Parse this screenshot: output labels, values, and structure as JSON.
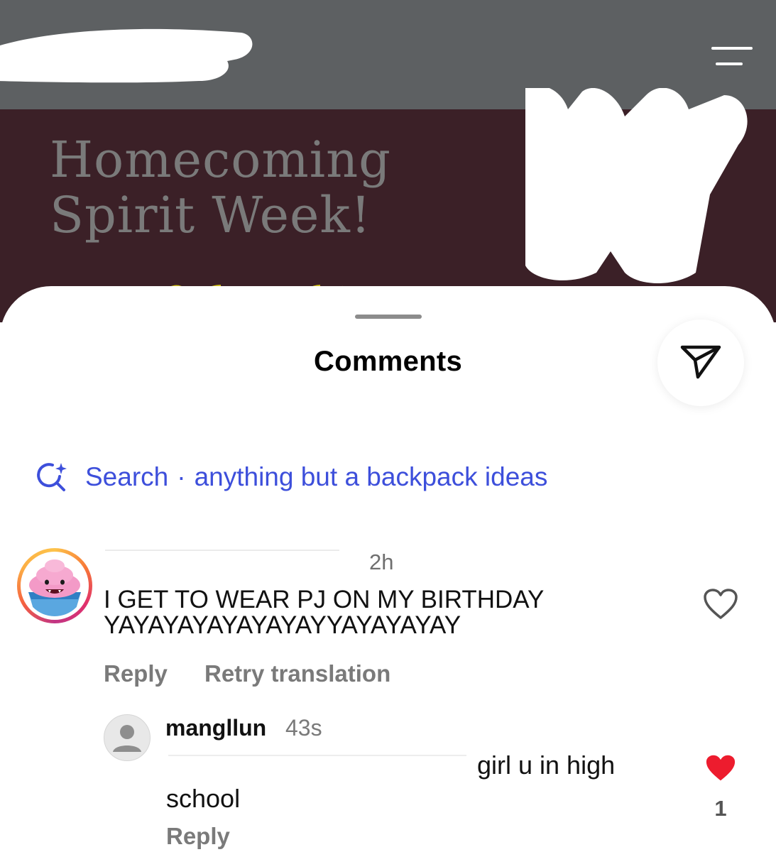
{
  "post": {
    "title": "Homecoming\nSpirit Week!"
  },
  "sheet": {
    "title": "Comments"
  },
  "search": {
    "label": "Search",
    "separator": "·",
    "suggestion": "anything but a backpack ideas"
  },
  "comment": {
    "time": "2h",
    "text": "I GET TO WEAR PJ ON MY BIRTHDAY\nYAYAYAYAYAYAYAYYAYAYAYAY",
    "reply_label": "Reply",
    "retry_label": "Retry translation"
  },
  "reply": {
    "username": "mangllun",
    "time": "43s",
    "text_line1": "girl u in high",
    "text_line2": "school",
    "reply_label": "Reply",
    "like_count": "1"
  },
  "icons": {
    "menu": "menu-icon",
    "share": "paper-plane-icon",
    "search": "search-sparkle-icon",
    "like": "heart-outline-icon",
    "liked": "heart-filled-icon"
  },
  "colors": {
    "topbar": "#5d6062",
    "post_bg": "#3b2027",
    "search_accent": "#3d4fdb",
    "liked_heart": "#ed1c2e"
  }
}
